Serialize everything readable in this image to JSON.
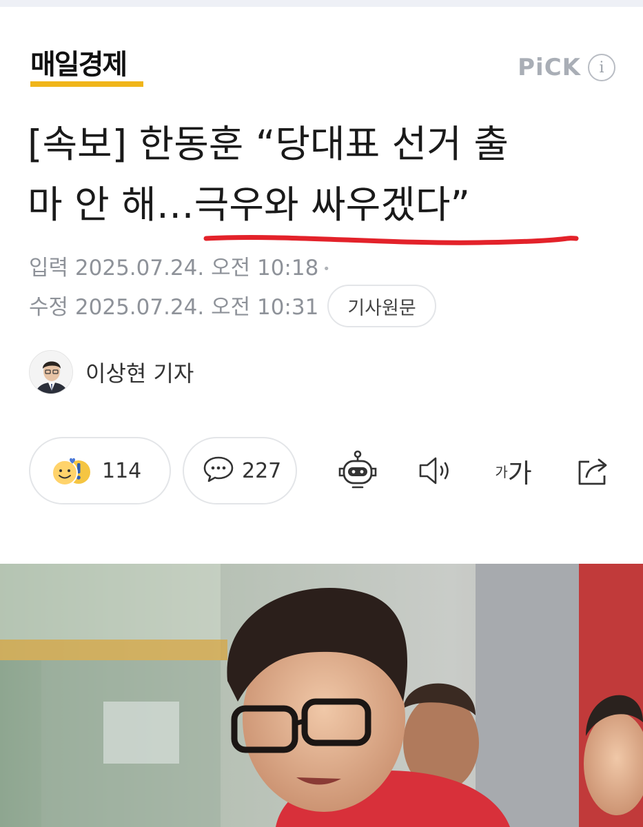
{
  "press": {
    "name": "매일경제",
    "underline_color": "#f0b51a"
  },
  "pick": {
    "label": "PiCK",
    "info_glyph": "i"
  },
  "article": {
    "headline_line1": "[속보] 한동훈 “당대표 선거 출",
    "headline_line2": "마 안 해…극우와 싸우겠다”",
    "annotation_color": "#e3222a"
  },
  "meta": {
    "published": "입력 2025.07.24. 오전 10:18",
    "modified": "수정 2025.07.24. 오전 10:31",
    "original_button": "기사원문"
  },
  "reporter": {
    "name": "이상현 기자"
  },
  "actions": {
    "reaction_count": "114",
    "comment_count": "227",
    "font_small": "가",
    "font_big": "가"
  },
  "icons": [
    "robot-summary-icon",
    "speaker-icon",
    "font-size-icon",
    "share-icon"
  ]
}
